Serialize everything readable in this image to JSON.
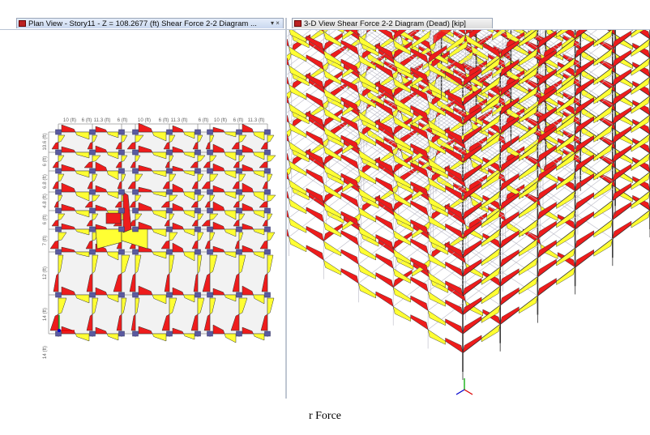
{
  "left_tab": {
    "title": "Plan View - Story11 - Z = 108.2677 (ft)    Shear Force 2-2 Diagram    ...",
    "controls": "▾ ×",
    "plan": {
      "top_dims": [
        "10 (ft)",
        "6 (ft)",
        "11.3 (ft)",
        "6 (ft)",
        "10 (ft)",
        "6 (ft)",
        "11.3 (ft)",
        "6 (ft)",
        "10 (ft)",
        "6 (ft)",
        "11.3 (ft)"
      ],
      "left_dims": [
        "10.6 (ft)",
        "6 (ft)",
        "6.8 (ft)",
        "4.8 (ft)",
        "6 (ft)",
        "7 (ft)",
        "12 (ft)",
        "14 (ft)",
        "14 (ft)"
      ]
    }
  },
  "right_tab": {
    "title": "3-D View    Shear Force 2-2 Diagram    (Dead)  [kip]"
  },
  "caption": "r Force",
  "colors": {
    "positive": "#ffff33",
    "negative": "#ee1c1c",
    "column": "#5a5aa0",
    "frame": "#7a7a90",
    "tab_active": "#c9d7ef"
  },
  "icons": [
    "view-icon",
    "dropdown-arrow-icon",
    "close-icon",
    "axis-icon"
  ]
}
